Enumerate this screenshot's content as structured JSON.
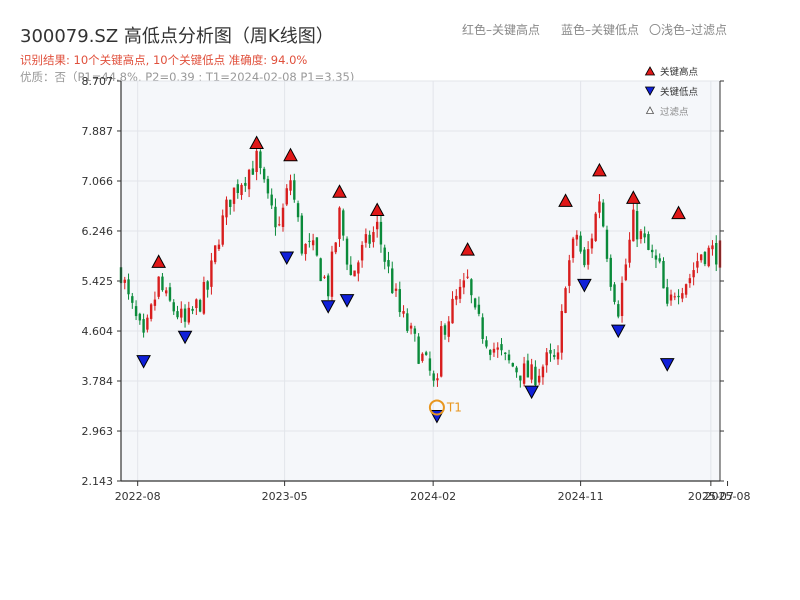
{
  "header": {
    "title": "300079.SZ 高低点分析图（周K线图）",
    "legend_red": "红色–关键高点",
    "legend_blue": "蓝色–关键低点",
    "legend_light": "〇浅色–过滤点",
    "result": "识别结果: 10个关键高点, 10个关键低点   准确度: 94.0%",
    "quality": "优质：否（P1=44.8%, P2=0.39 ; T1=2024-02-08 P1=3.35)"
  },
  "colors": {
    "up": "#d81e1e",
    "down": "#0a8a3a",
    "high_marker": "#e01818",
    "low_marker": "#1020d8",
    "t1": "#e8961e",
    "plot_bg": "#f5f7fa",
    "grid": "#e2e5ea"
  },
  "chart_data": {
    "type": "candlestick",
    "ylim": [
      2.143,
      8.707
    ],
    "y_ticks": [
      "2.143",
      "2.963",
      "3.784",
      "4.604",
      "5.425",
      "6.246",
      "7.066",
      "7.887",
      "8.707"
    ],
    "x_start": "2022-07-01",
    "x_end": "2025-07-18",
    "x_ticks": [
      {
        "date": "2022-08-01",
        "label": "2022-08"
      },
      {
        "date": "2023-05-01",
        "label": "2023-05"
      },
      {
        "date": "2024-02-01",
        "label": "2024-02"
      },
      {
        "date": "2024-11-01",
        "label": "2024-11"
      },
      {
        "date": "2025-07-01",
        "label": "2025-07"
      },
      {
        "date": "2025-08-01",
        "label": "2025-08"
      }
    ],
    "price_path": [
      [
        "2022-07-01",
        5.6
      ],
      [
        "2022-07-15",
        5.1
      ],
      [
        "2022-08-05",
        4.6
      ],
      [
        "2022-08-12",
        4.4
      ],
      [
        "2022-09-09",
        5.4
      ],
      [
        "2022-09-23",
        5.1
      ],
      [
        "2022-10-14",
        4.9
      ],
      [
        "2022-10-28",
        4.7
      ],
      [
        "2022-11-18",
        5.0
      ],
      [
        "2022-12-09",
        5.3
      ],
      [
        "2022-12-30",
        6.2
      ],
      [
        "2023-01-20",
        6.8
      ],
      [
        "2023-02-10",
        7.1
      ],
      [
        "2023-03-10",
        7.4
      ],
      [
        "2023-03-31",
        6.7
      ],
      [
        "2023-04-21",
        6.3
      ],
      [
        "2023-05-12",
        7.1
      ],
      [
        "2023-06-02",
        6.0
      ],
      [
        "2023-06-23",
        5.9
      ],
      [
        "2023-07-21",
        5.3
      ],
      [
        "2023-08-11",
        6.5
      ],
      [
        "2023-09-01",
        5.5
      ],
      [
        "2023-09-22",
        5.9
      ],
      [
        "2023-10-20",
        6.3
      ],
      [
        "2023-11-03",
        5.8
      ],
      [
        "2023-12-01",
        4.9
      ],
      [
        "2023-12-29",
        4.4
      ],
      [
        "2024-01-26",
        3.9
      ],
      [
        "2024-02-08",
        3.5
      ],
      [
        "2024-02-16",
        4.6
      ],
      [
        "2024-03-08",
        5.0
      ],
      [
        "2024-04-05",
        5.4
      ],
      [
        "2024-04-19",
        4.8
      ],
      [
        "2024-05-17",
        4.4
      ],
      [
        "2024-06-14",
        4.1
      ],
      [
        "2024-07-12",
        3.95
      ],
      [
        "2024-08-02",
        3.85
      ],
      [
        "2024-08-30",
        4.1
      ],
      [
        "2024-09-20",
        4.1
      ],
      [
        "2024-10-04",
        5.5
      ],
      [
        "2024-10-25",
        6.2
      ],
      [
        "2024-11-08",
        5.6
      ],
      [
        "2024-12-06",
        6.8
      ],
      [
        "2024-12-27",
        5.5
      ],
      [
        "2025-01-10",
        5.0
      ],
      [
        "2025-02-07",
        6.4
      ],
      [
        "2025-03-07",
        5.9
      ],
      [
        "2025-03-28",
        5.6
      ],
      [
        "2025-04-11",
        4.9
      ],
      [
        "2025-04-25",
        5.3
      ],
      [
        "2025-05-23",
        5.5
      ],
      [
        "2025-06-13",
        5.9
      ],
      [
        "2025-07-18",
        5.9
      ]
    ],
    "key_highs": [
      {
        "date": "2022-09-09",
        "price": 5.6
      },
      {
        "date": "2023-03-10",
        "price": 7.55
      },
      {
        "date": "2023-05-12",
        "price": 7.35
      },
      {
        "date": "2023-08-11",
        "price": 6.75
      },
      {
        "date": "2023-10-20",
        "price": 6.45
      },
      {
        "date": "2024-04-05",
        "price": 5.8
      },
      {
        "date": "2024-10-04",
        "price": 6.6
      },
      {
        "date": "2024-12-06",
        "price": 7.1
      },
      {
        "date": "2025-02-07",
        "price": 6.65
      },
      {
        "date": "2025-05-02",
        "price": 6.4
      }
    ],
    "key_lows": [
      {
        "date": "2022-08-12",
        "price": 4.25
      },
      {
        "date": "2022-10-28",
        "price": 4.65
      },
      {
        "date": "2023-05-05",
        "price": 5.95
      },
      {
        "date": "2023-07-21",
        "price": 5.15
      },
      {
        "date": "2023-08-25",
        "price": 5.25
      },
      {
        "date": "2024-02-08",
        "price": 3.35
      },
      {
        "date": "2024-08-02",
        "price": 3.75
      },
      {
        "date": "2024-11-08",
        "price": 5.5
      },
      {
        "date": "2025-01-10",
        "price": 4.75
      },
      {
        "date": "2025-04-11",
        "price": 4.2
      }
    ],
    "t1": {
      "date": "2024-02-08",
      "price": 3.35,
      "label": "T1"
    },
    "legend": {
      "high": "关键高点",
      "low": "关键低点",
      "filtered": "过滤点",
      "position": "top-right"
    },
    "grid": true
  }
}
